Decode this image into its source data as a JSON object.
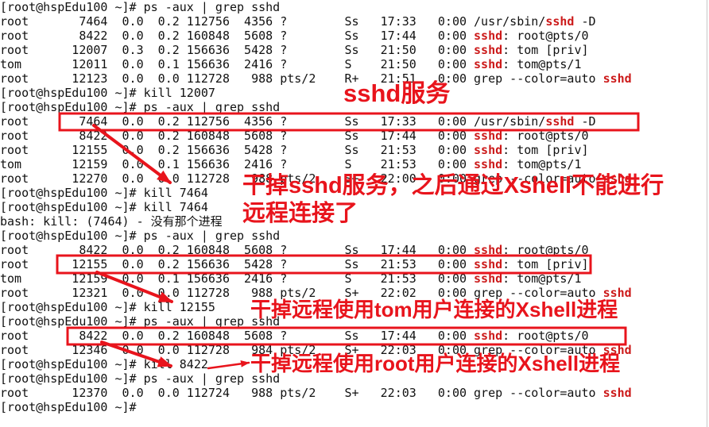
{
  "colors": {
    "terminal_text": "#111111",
    "terminal_background": "#ffffff",
    "grep_match": "#cc1a1a",
    "annotation": "#e8141c"
  },
  "terminal": {
    "lines": [
      [
        {
          "t": "[root@hspEdu100 ~]# ps -aux | grep sshd"
        }
      ],
      [
        {
          "t": "root       7464  0.0  0.2 112756  4356 ?        Ss   17:33   0:00 /usr/sbin/"
        },
        {
          "t": "sshd",
          "match": true
        },
        {
          "t": " -D"
        }
      ],
      [
        {
          "t": "root       8422  0.0  0.2 160848  5608 ?        Ss   17:44   0:00 "
        },
        {
          "t": "sshd",
          "match": true
        },
        {
          "t": ": root@pts/0"
        }
      ],
      [
        {
          "t": "root      12007  0.3  0.2 156636  5428 ?        Ss   21:50   0:00 "
        },
        {
          "t": "sshd",
          "match": true
        },
        {
          "t": ": tom [priv]"
        }
      ],
      [
        {
          "t": "tom       12011  0.0  0.1 156636  2416 ?        S    21:50   0:00 "
        },
        {
          "t": "sshd",
          "match": true
        },
        {
          "t": ": tom@pts/1"
        }
      ],
      [
        {
          "t": "root      12123  0.0  0.0 112728   988 pts/2    R+   21:51   0:00 grep --color=auto "
        },
        {
          "t": "sshd",
          "match": true
        }
      ],
      [
        {
          "t": "[root@hspEdu100 ~]# kill 12007"
        }
      ],
      [
        {
          "t": "[root@hspEdu100 ~]# ps -aux | grep sshd"
        }
      ],
      [
        {
          "t": "root       7464  0.0  0.2 112756  4356 ?        Ss   17:33   0:00 /usr/sbin/"
        },
        {
          "t": "sshd",
          "match": true
        },
        {
          "t": " -D"
        }
      ],
      [
        {
          "t": "root       8422  0.0  0.2 160848  5608 ?        Ss   17:44   0:00 "
        },
        {
          "t": "sshd",
          "match": true
        },
        {
          "t": ": root@pts/0"
        }
      ],
      [
        {
          "t": "root      12155  0.0  0.2 156636  5428 ?        Ss   21:53   0:00 "
        },
        {
          "t": "sshd",
          "match": true
        },
        {
          "t": ": tom [priv]"
        }
      ],
      [
        {
          "t": "tom       12159  0.0  0.1 156636  2416 ?        S    21:53   0:00 "
        },
        {
          "t": "sshd",
          "match": true
        },
        {
          "t": ": tom@pts/1"
        }
      ],
      [
        {
          "t": "root      12270  0.0  0.0 112728   988 pts/2    S+   22:00   0:00 grep --color=auto "
        },
        {
          "t": "sshd",
          "match": true
        }
      ],
      [
        {
          "t": "[root@hspEdu100 ~]# kill 7464"
        }
      ],
      [
        {
          "t": "[root@hspEdu100 ~]# kill 7464"
        }
      ],
      [
        {
          "t": "bash: kill: (7464) - 没有那个进程"
        }
      ],
      [
        {
          "t": "[root@hspEdu100 ~]# ps -aux | grep sshd"
        }
      ],
      [
        {
          "t": "root       8422  0.0  0.2 160848  5608 ?        Ss   17:44   0:00 "
        },
        {
          "t": "sshd",
          "match": true
        },
        {
          "t": ": root@pts/0"
        }
      ],
      [
        {
          "t": "root      12155  0.0  0.2 156636  5428 ?        Ss   21:53   0:00 "
        },
        {
          "t": "sshd",
          "match": true
        },
        {
          "t": ": tom [priv]"
        }
      ],
      [
        {
          "t": "tom       12159  0.0  0.1 156636  2416 ?        S    21:53   0:00 "
        },
        {
          "t": "sshd",
          "match": true
        },
        {
          "t": ": tom@pts/1"
        }
      ],
      [
        {
          "t": "root      12321  0.0  0.0 112728   988 pts/2    S+   22:02   0:00 grep --color=auto "
        },
        {
          "t": "sshd",
          "match": true
        }
      ],
      [
        {
          "t": "[root@hspEdu100 ~]# kill 12155"
        }
      ],
      [
        {
          "t": "[root@hspEdu100 ~]# ps -aux | grep sshd"
        }
      ],
      [
        {
          "t": "root       8422  0.0  0.2 160848  5608 ?        Ss   17:44   0:00 "
        },
        {
          "t": "sshd",
          "match": true
        },
        {
          "t": ": root@pts/0"
        }
      ],
      [
        {
          "t": "root      12346  0.0  0.0 112728   984 pts/2    S+   22:03   0:00 grep --color=auto "
        },
        {
          "t": "sshd",
          "match": true
        }
      ],
      [
        {
          "t": "[root@hspEdu100 ~]# kill 8422"
        }
      ],
      [
        {
          "t": "[root@hspEdu100 ~]# ps -aux | grep sshd"
        }
      ],
      [
        {
          "t": "root      12370  0.0  0.0 112724   988 pts/2    S+   22:03   0:00 grep --color=auto "
        },
        {
          "t": "sshd",
          "match": true
        }
      ],
      [
        {
          "t": "[root@hspEdu100 ~]# "
        }
      ]
    ]
  },
  "annotations": {
    "sshd_service": "sshd服务",
    "kill_sshd_line1": "干掉sshd服务，之后通过Xshell不能进行",
    "kill_sshd_line2": "远程连接了",
    "kill_tom": "干掉远程使用tom用户连接的Xshell进程",
    "kill_root": "干掉远程使用root用户连接的Xshell进程"
  }
}
